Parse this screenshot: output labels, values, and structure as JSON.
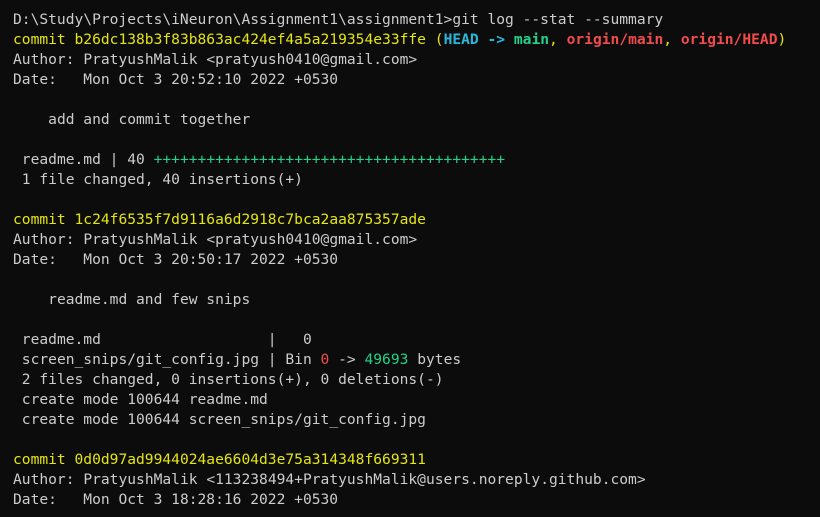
{
  "prompt": {
    "path": "D:\\Study\\Projects\\iNeuron\\Assignment1\\assignment1>",
    "command": "git log --stat --summary"
  },
  "commits": [
    {
      "label": "commit",
      "hash": "b26dc138b3f83b863ac424ef4a5a219354e33ffe",
      "refs": {
        "open": "(",
        "head": "HEAD ->",
        "branch": "main",
        "sep1": ", ",
        "origin_main": "origin/main",
        "sep2": ", ",
        "origin_head": "origin/HEAD",
        "close": ")"
      },
      "author_label": "Author:",
      "author": "PratyushMalik <pratyush0410@gmail.com>",
      "date_label": "Date:",
      "date": "Mon Oct 3 20:52:10 2022 +0530",
      "message": "add and commit together",
      "stat_file": "readme.md | 40",
      "stat_bar": "++++++++++++++++++++++++++++++++++++++++",
      "summary": "1 file changed, 40 insertions(+)"
    },
    {
      "label": "commit",
      "hash": "1c24f6535f7d9116a6d2918c7bca2aa875357ade",
      "author_label": "Author:",
      "author": "PratyushMalik <pratyush0410@gmail.com>",
      "date_label": "Date:",
      "date": "Mon Oct 3 20:50:17 2022 +0530",
      "message": "readme.md and few snips",
      "stat1": "readme.md                   |   0",
      "stat2_file": "screen_snips/git_config.jpg | Bin ",
      "stat2_from": "0",
      "stat2_arrow": " -> ",
      "stat2_to": "49693",
      "stat2_unit": " bytes",
      "summary": "2 files changed, 0 insertions(+), 0 deletions(-)",
      "create1": "create mode 100644 readme.md",
      "create2": "create mode 100644 screen_snips/git_config.jpg"
    },
    {
      "label": "commit",
      "hash": "0d0d97ad9944024ae6604d3e75a314348f669311",
      "author_label": "Author:",
      "author": "PratyushMalik <113238494+PratyushMalik@users.noreply.github.com>",
      "date_label": "Date:",
      "date": "Mon Oct 3 18:28:16 2022 +0530"
    }
  ],
  "colors": {
    "background": "#0c0c0c",
    "text": "#cccccc",
    "commit_yellow": "#e5e510",
    "head_cyan": "#29b8db",
    "branch_green": "#23d18b",
    "origin_red": "#f14c4c"
  }
}
